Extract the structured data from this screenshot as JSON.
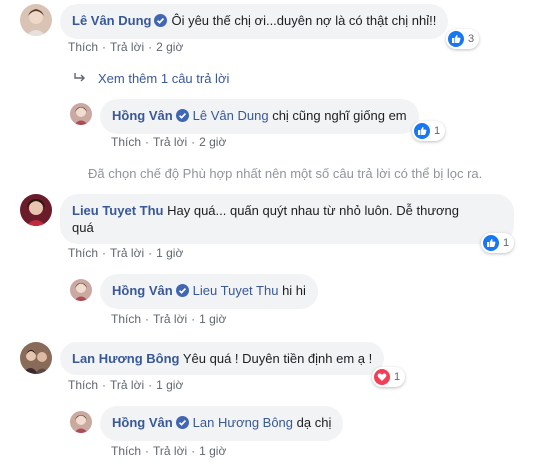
{
  "comments": [
    {
      "author": "Lê Vân Dung",
      "text": "Ôi yêu thế chị ơi...duyên nợ là có thật chị nhỉ!!",
      "like_label": "Thích",
      "reply_label": "Trả lời",
      "time": "2 giờ",
      "reaction_count": "3",
      "reaction_type": "like"
    },
    {
      "author": "Liêu Tuyet Thu",
      "author_display": "Lieu Tuyet Thu",
      "text_line1": "Hay quá... quấn quýt nhau từ nhỏ luôn. Dễ thương",
      "text_line2": "quá",
      "like_label": "Thích",
      "reply_label": "Trả lời",
      "time": "1 giờ",
      "reaction_count": "1",
      "reaction_type": "like"
    },
    {
      "author": "Lan Hương Bông",
      "text": "Yêu quá ! Duyên tiền định em ạ !",
      "like_label": "Thích",
      "reply_label": "Trả lời",
      "time": "1 giờ",
      "reaction_count": "1",
      "reaction_type": "love"
    }
  ],
  "replies": [
    {
      "author": "Hồng Vân",
      "mention": "Lê Vân Dung",
      "text": "chị cũng nghĩ giống em",
      "like_label": "Thích",
      "reply_label": "Trả lời",
      "time": "2 giờ",
      "reaction_count": "1",
      "reaction_type": "like"
    },
    {
      "author": "Hồng Vân",
      "mention": "Lieu Tuyet Thu",
      "text": "hi hi",
      "like_label": "Thích",
      "reply_label": "Trả lời",
      "time": "1 giờ"
    },
    {
      "author": "Hồng Vân",
      "mention": "Lan Hương Bông",
      "text": "dạ chị",
      "like_label": "Thích",
      "reply_label": "Trả lời",
      "time": "1 giờ"
    }
  ],
  "more_replies_label": "Xem thêm 1 câu trả lời",
  "filter_note": "Đã chọn chế độ Phù hợp nhất nên một số câu trả lời có thể bị lọc ra.",
  "colors": {
    "link": "#385898",
    "meta": "#606770",
    "bubble": "#f2f3f5",
    "like": "#1877f2",
    "love": "#f33e58",
    "verified": "#4267b2"
  }
}
